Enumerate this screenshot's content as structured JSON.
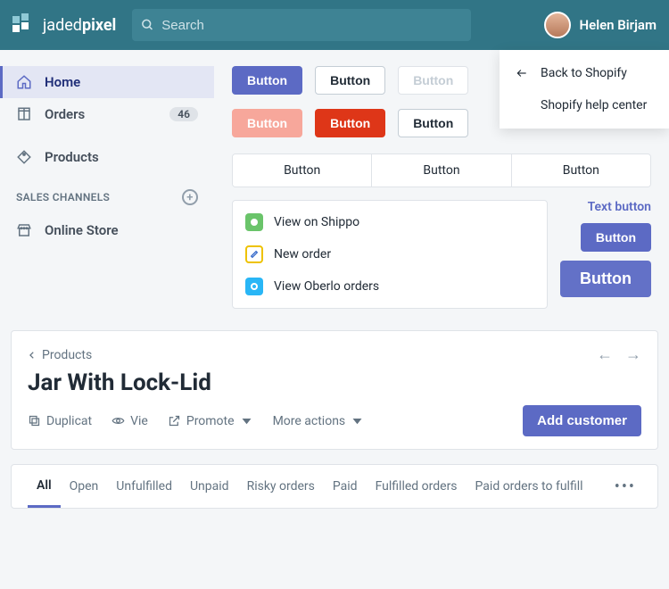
{
  "topbar": {
    "brand_light": "jaded",
    "brand_bold": "pixel",
    "search_placeholder": "Search",
    "user_name": "Helen Birjam"
  },
  "dropdown": {
    "back": "Back to Shopify",
    "help": "Shopify help center"
  },
  "sidebar": {
    "home": "Home",
    "orders": "Orders",
    "orders_badge": "46",
    "products": "Products",
    "channels_head": "SALES CHANNELS",
    "online_store": "Online Store"
  },
  "buttons": {
    "row1": [
      "Button",
      "Button",
      "Button"
    ],
    "row2": [
      "Button",
      "Button",
      "Button"
    ],
    "seg": [
      "Button",
      "Button",
      "Button"
    ],
    "text_button": "Text button",
    "small": "Button",
    "large": "Button"
  },
  "actions": {
    "shippo": "View on Shippo",
    "new_order": "New order",
    "oberlo": "View Oberlo orders"
  },
  "page": {
    "breadcrumb": "Products",
    "title": "Jar With Lock-Lid",
    "duplicate": "Duplicat",
    "view": "Vie",
    "promote": "Promote",
    "more_actions": "More actions",
    "add_customer": "Add customer"
  },
  "tabs": [
    "All",
    "Open",
    "Unfulfilled",
    "Unpaid",
    "Risky orders",
    "Paid",
    "Fulfilled orders",
    "Paid orders to fulfill"
  ]
}
